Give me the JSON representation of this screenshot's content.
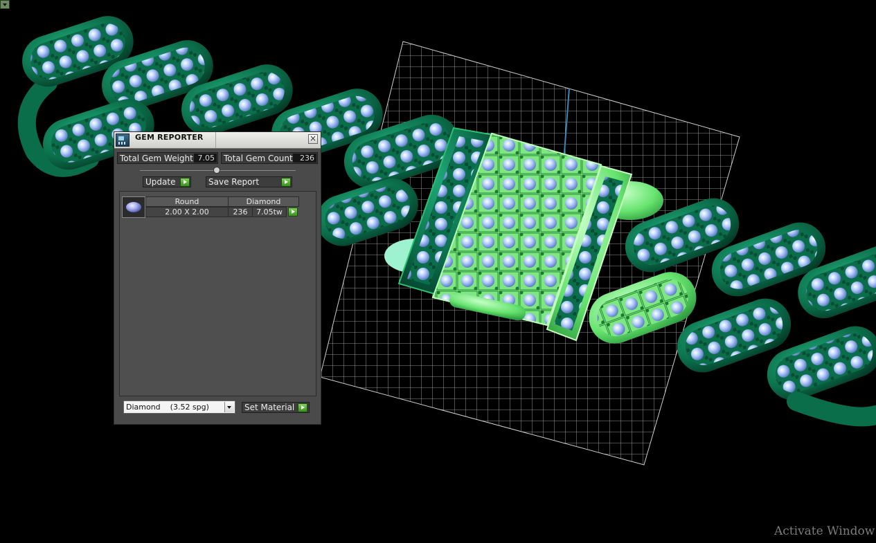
{
  "panel": {
    "title": "GEM REPORTER",
    "close_glyph": "×",
    "total_weight_label": "Total Gem Weight",
    "total_weight_value": "7.05",
    "total_count_label": "Total Gem Count",
    "total_count_value": "236",
    "update_label": "Update",
    "save_report_label": "Save Report",
    "list": {
      "shape": "Round",
      "material": "Diamond",
      "size": "2.00 X 2.00",
      "count": "236",
      "weight": "7.05tw"
    },
    "material_select_value": "Diamond    (3.52 spg)",
    "set_material_label": "Set Material"
  },
  "watermark": "Activate Window",
  "colors": {
    "metal": "#0d7a55",
    "metal_highlight": "#7ef08a",
    "gem": "#a9c8ff",
    "accent_green": "#4db52e"
  },
  "icons": {
    "corner": "dropdown-arrow-icon",
    "title": "gem-reporter-icon",
    "close": "close-icon",
    "go": "play-arrow-icon",
    "thumb": "round-gem-icon"
  }
}
